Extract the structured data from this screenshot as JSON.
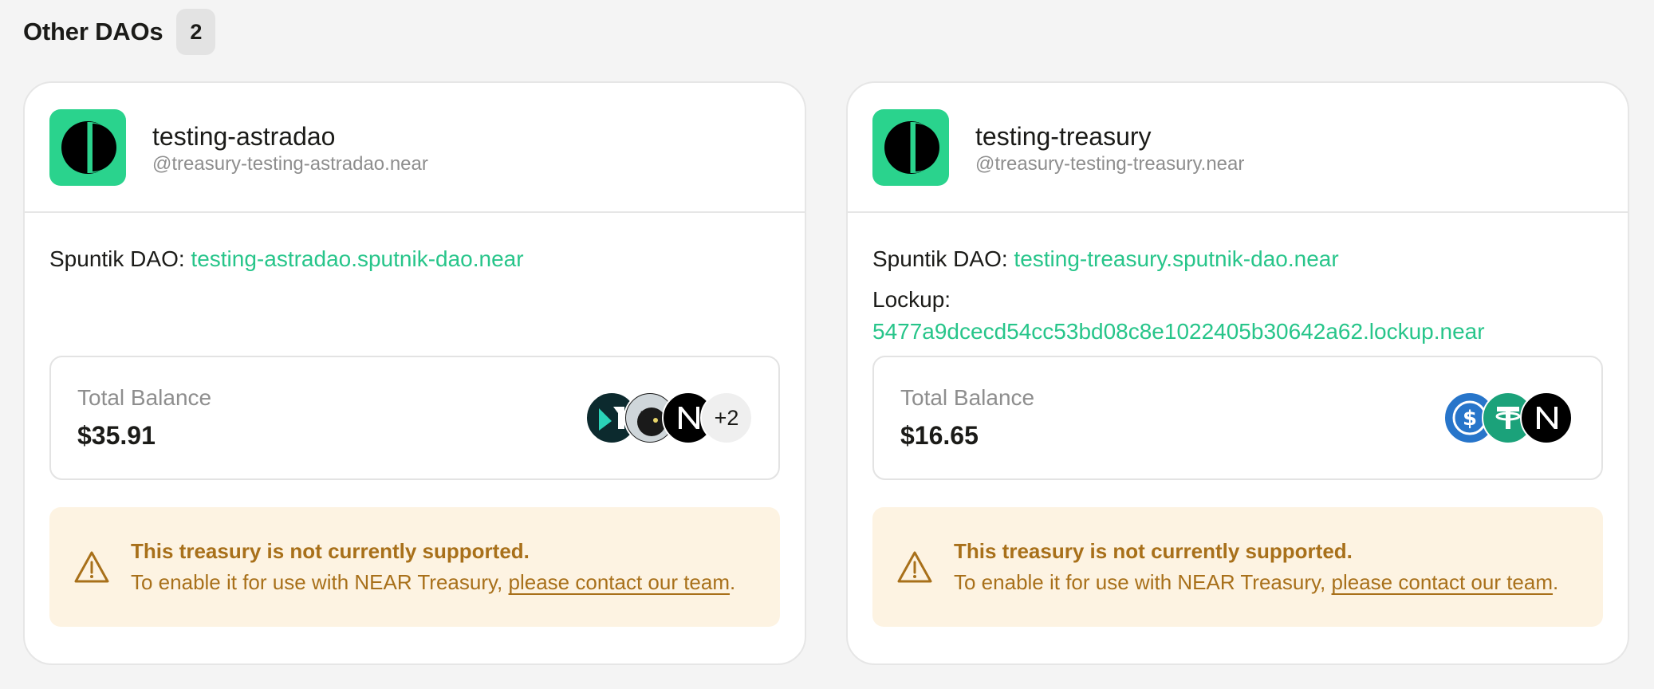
{
  "header": {
    "title": "Other DAOs",
    "count": "2"
  },
  "cards": [
    {
      "name": "testing-astradao",
      "account": "@treasury-testing-astradao.near",
      "sputnik_label": "Spuntik DAO:",
      "sputnik_link": "testing-astradao.sputnik-dao.near",
      "balance_label": "Total Balance",
      "balance_value": "$35.91",
      "tokens": [
        "meta-pool-icon",
        "cat-token-icon",
        "near-icon"
      ],
      "more_tokens": "+2",
      "warning_title": "This treasury is not currently supported.",
      "warning_text": "To enable it for use with NEAR Treasury,",
      "warning_link": "please contact our team",
      "warning_end": "."
    },
    {
      "name": "testing-treasury",
      "account": "@treasury-testing-treasury.near",
      "sputnik_label": "Spuntik DAO:",
      "sputnik_link": "testing-treasury.sputnik-dao.near",
      "lockup_label": "Lockup:",
      "lockup_link": "5477a9dcecd54cc53bd08c8e1022405b30642a62.lockup.near",
      "balance_label": "Total Balance",
      "balance_value": "$16.65",
      "tokens": [
        "usdc-icon",
        "usdt-icon",
        "near-icon"
      ],
      "warning_title": "This treasury is not currently supported.",
      "warning_text": "To enable it for use with NEAR Treasury,",
      "warning_link": "please contact our team",
      "warning_end": "."
    }
  ],
  "colors": {
    "accent": "#2ad38d",
    "link": "#27c58a",
    "warning_bg": "#fdf3e2",
    "warning_text": "#a8701a"
  }
}
